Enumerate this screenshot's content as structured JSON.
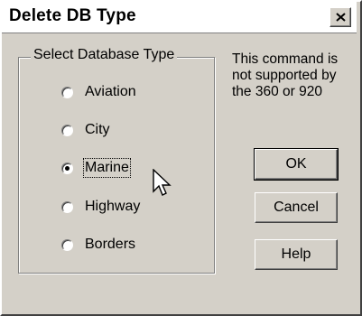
{
  "dialog": {
    "title": "Delete DB Type",
    "close_glyph": "×"
  },
  "group": {
    "legend": "Select Database Type",
    "options": [
      {
        "label": "Aviation",
        "checked": false
      },
      {
        "label": "City",
        "checked": false
      },
      {
        "label": "Marine",
        "checked": true
      },
      {
        "label": "Highway",
        "checked": false
      },
      {
        "label": "Borders",
        "checked": false
      }
    ]
  },
  "note": {
    "lines": [
      "This command is",
      "not supported by",
      "the 360 or 920"
    ]
  },
  "buttons": {
    "ok": "OK",
    "cancel": "Cancel",
    "help": "Help"
  },
  "icons": {
    "close": "close-icon",
    "cursor": "arrow-cursor-icon"
  }
}
